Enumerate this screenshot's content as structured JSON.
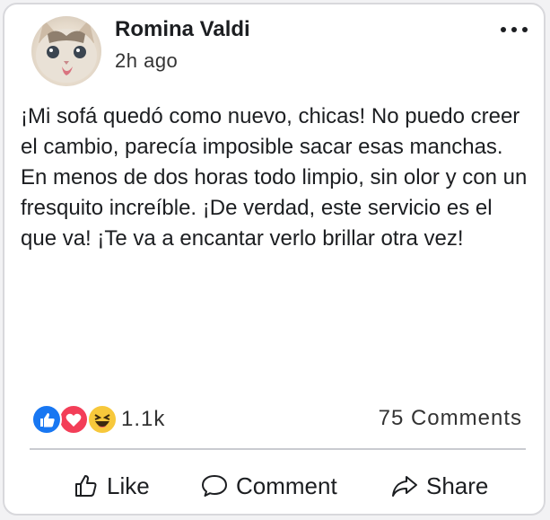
{
  "post": {
    "author": "Romina Valdi",
    "timestamp": "2h ago",
    "text": "¡Mi sofá quedó como nuevo, chicas! No puedo creer el cambio, parecía imposible sacar esas manchas. En menos de dos horas todo limpio, sin olor y con un fresquito increíble. ¡De verdad, este servicio es el que va! ¡Te va a encantar verlo brillar otra vez!",
    "more_icon": "more-horizontal-icon"
  },
  "reactions": {
    "icons": [
      "like-icon",
      "love-icon",
      "haha-icon"
    ],
    "count": "1.1k",
    "colors": {
      "like": "#1877f2",
      "love": "#f33e58",
      "haha": "#f7c83b"
    }
  },
  "comments": {
    "count_label": "75 Comments"
  },
  "actions": {
    "like_label": "Like",
    "comment_label": "Comment",
    "share_label": "Share"
  }
}
